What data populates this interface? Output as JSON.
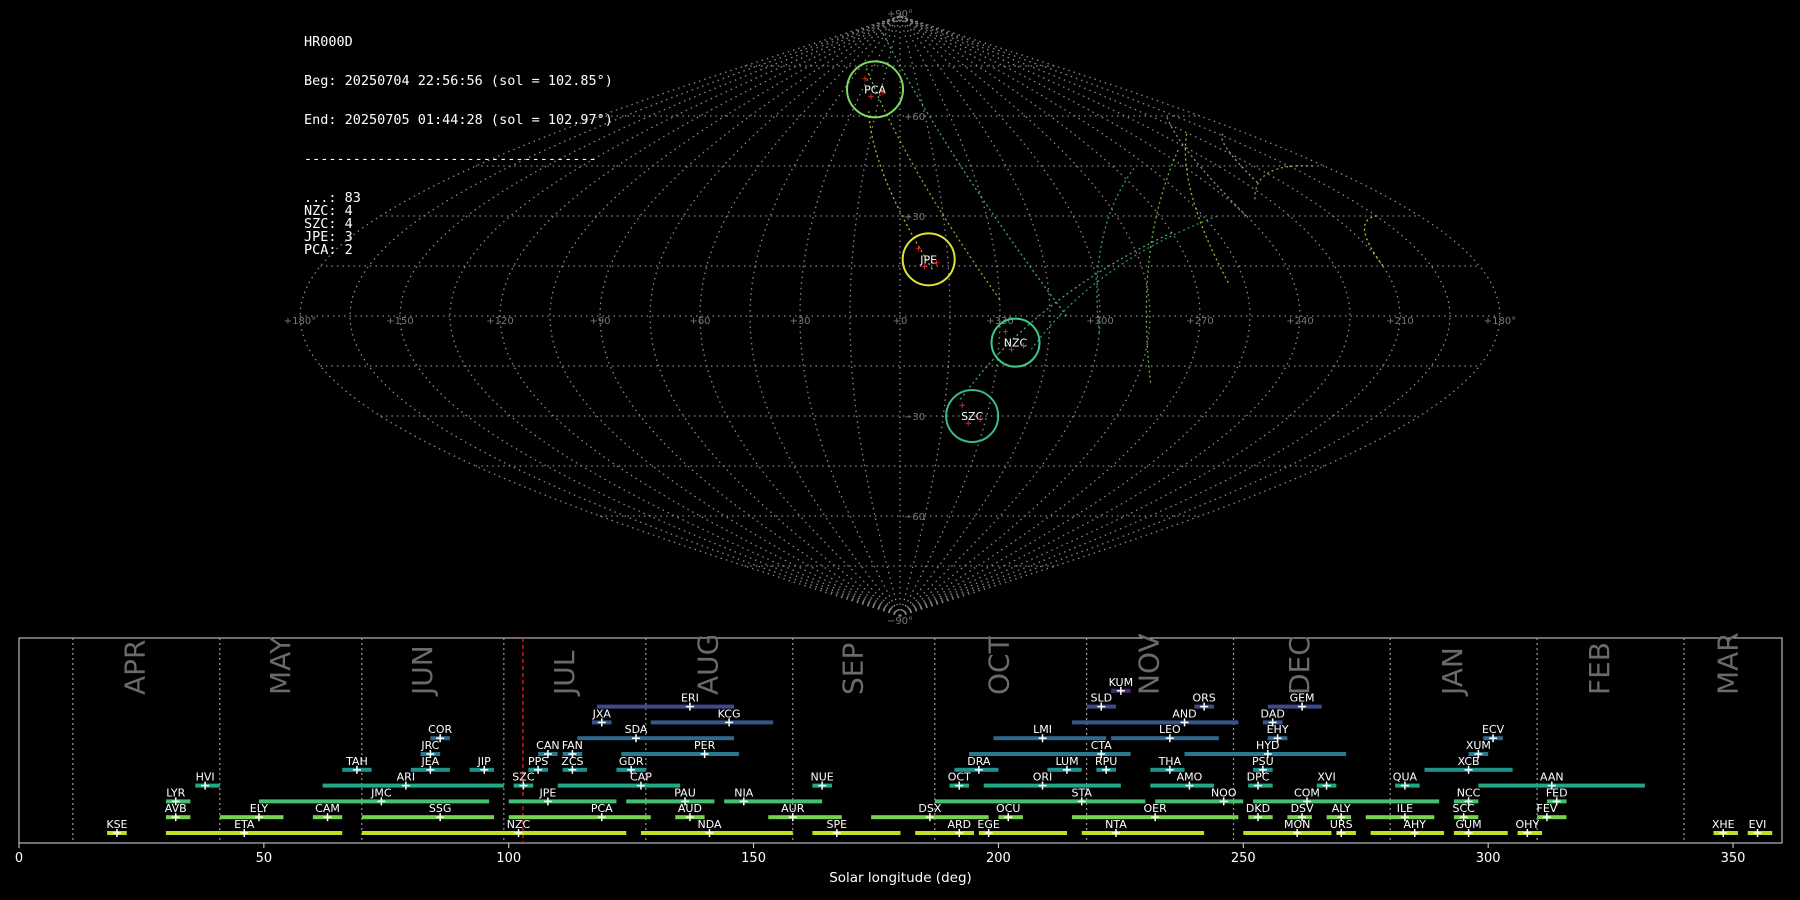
{
  "info": {
    "station": "HR000D",
    "beg": "Beg: 20250704 22:56:56 (sol = 102.85°)",
    "end": "End: 20250705 01:44:28 (sol = 102.97°)",
    "separator": "------------------------------------",
    "counts": [
      {
        "label": "...",
        "value": "83"
      },
      {
        "label": "NZC",
        "value": "4"
      },
      {
        "label": "SZC",
        "value": "4"
      },
      {
        "label": "JPE",
        "value": "3"
      },
      {
        "label": "PCA",
        "value": "2"
      }
    ]
  },
  "sky_map": {
    "projection": "sinusoidal",
    "pole_labels": [
      "+90°",
      "−90°"
    ],
    "lat_labels": [
      {
        "lat": 60,
        "text": "+60"
      },
      {
        "lat": 30,
        "text": "+30"
      },
      {
        "lat": -30,
        "text": "−30"
      },
      {
        "lat": -60,
        "text": "−60"
      }
    ],
    "lon_labels": [
      "+180°",
      "+150",
      "+120",
      "+90",
      "+60",
      "+30",
      "+0",
      "+330",
      "+300",
      "+270",
      "+240",
      "+210",
      "+180°"
    ],
    "showers": [
      {
        "code": "PCA",
        "lon": 20,
        "lat": 68,
        "r": 28,
        "color": "#7fd860"
      },
      {
        "code": "JPE",
        "lon": -9,
        "lat": 17,
        "r": 26,
        "color": "#e0e23a"
      },
      {
        "code": "NZC",
        "lon": -35,
        "lat": -8,
        "r": 24,
        "color": "#3fc888"
      },
      {
        "code": "SZC",
        "lon": -25,
        "lat": -30,
        "r": 26,
        "color": "#36b890"
      }
    ]
  },
  "chart_data": {
    "type": "timeline",
    "xlabel": "Solar longitude (deg)",
    "xlim": [
      0,
      360
    ],
    "xticks": [
      0,
      50,
      100,
      150,
      200,
      250,
      300,
      350
    ],
    "current_sol": 102.9,
    "months": [
      {
        "label": "APR",
        "start": 11,
        "end": 41
      },
      {
        "label": "MAY",
        "start": 41,
        "end": 70
      },
      {
        "label": "JUN",
        "start": 70,
        "end": 99
      },
      {
        "label": "JUL",
        "start": 99,
        "end": 128
      },
      {
        "label": "AUG",
        "start": 128,
        "end": 158
      },
      {
        "label": "SEP",
        "start": 158,
        "end": 187
      },
      {
        "label": "OCT",
        "start": 187,
        "end": 218
      },
      {
        "label": "NOV",
        "start": 218,
        "end": 248
      },
      {
        "label": "DEC",
        "start": 248,
        "end": 280
      },
      {
        "label": "JAN",
        "start": 280,
        "end": 310
      },
      {
        "label": "FEB",
        "start": 310,
        "end": 340
      },
      {
        "label": "MAR",
        "start": 340,
        "end": 371
      }
    ],
    "showers": [
      {
        "code": "KUM",
        "row": 9,
        "start": 223,
        "end": 227,
        "peak": 225,
        "color": "#482878"
      },
      {
        "code": "ERI",
        "row": 8,
        "start": 118,
        "end": 146,
        "peak": 137,
        "color": "#3e4a89"
      },
      {
        "code": "SLD",
        "row": 8,
        "start": 218,
        "end": 224,
        "peak": 221,
        "color": "#3e4a89"
      },
      {
        "code": "ORS",
        "row": 8,
        "start": 240,
        "end": 244,
        "peak": 242,
        "color": "#3e4a89"
      },
      {
        "code": "GEM",
        "row": 8,
        "start": 255,
        "end": 266,
        "peak": 262,
        "color": "#3e4a89"
      },
      {
        "code": "JXA",
        "row": 7,
        "start": 117,
        "end": 121,
        "peak": 119,
        "color": "#39568c"
      },
      {
        "code": "KCG",
        "row": 7,
        "start": 129,
        "end": 154,
        "peak": 145,
        "color": "#39568c"
      },
      {
        "code": "AND",
        "row": 7,
        "start": 215,
        "end": 249,
        "peak": 238,
        "color": "#39568c"
      },
      {
        "code": "DAD",
        "row": 7,
        "start": 254,
        "end": 258,
        "peak": 256,
        "color": "#39568c"
      },
      {
        "code": "COR",
        "row": 6,
        "start": 84,
        "end": 88,
        "peak": 86,
        "color": "#31688e"
      },
      {
        "code": "SDA",
        "row": 6,
        "start": 114,
        "end": 146,
        "peak": 126,
        "color": "#31688e"
      },
      {
        "code": "LMI",
        "row": 6,
        "start": 199,
        "end": 222,
        "peak": 209,
        "color": "#31688e"
      },
      {
        "code": "LEO",
        "row": 6,
        "start": 223,
        "end": 245,
        "peak": 235,
        "color": "#31688e"
      },
      {
        "code": "EHY",
        "row": 6,
        "start": 255,
        "end": 259,
        "peak": 257,
        "color": "#31688e"
      },
      {
        "code": "ECV",
        "row": 6,
        "start": 299,
        "end": 303,
        "peak": 301,
        "color": "#31688e"
      },
      {
        "code": "JRC",
        "row": 5,
        "start": 82,
        "end": 86,
        "peak": 84,
        "color": "#2a788e"
      },
      {
        "code": "CAN",
        "row": 5,
        "start": 106,
        "end": 110,
        "peak": 108,
        "color": "#2a788e"
      },
      {
        "code": "FAN",
        "row": 5,
        "start": 111,
        "end": 115,
        "peak": 113,
        "color": "#2a788e"
      },
      {
        "code": "PER",
        "row": 5,
        "start": 123,
        "end": 147,
        "peak": 140,
        "color": "#2a788e"
      },
      {
        "code": "CTA",
        "row": 5,
        "start": 194,
        "end": 227,
        "peak": 221,
        "color": "#2a788e"
      },
      {
        "code": "HYD",
        "row": 5,
        "start": 238,
        "end": 271,
        "peak": 255,
        "color": "#2a788e"
      },
      {
        "code": "XUM",
        "row": 5,
        "start": 296,
        "end": 300,
        "peak": 298,
        "color": "#2a788e"
      },
      {
        "code": "TAH",
        "row": 4,
        "start": 66,
        "end": 72,
        "peak": 69,
        "color": "#21918c"
      },
      {
        "code": "JEA",
        "row": 4,
        "start": 80,
        "end": 88,
        "peak": 84,
        "color": "#21918c"
      },
      {
        "code": "JIP",
        "row": 4,
        "start": 92,
        "end": 97,
        "peak": 95,
        "color": "#21918c"
      },
      {
        "code": "PPS",
        "row": 4,
        "start": 104,
        "end": 108,
        "peak": 106,
        "color": "#21918c"
      },
      {
        "code": "ZCS",
        "row": 4,
        "start": 111,
        "end": 116,
        "peak": 113,
        "color": "#21918c"
      },
      {
        "code": "GDR",
        "row": 4,
        "start": 122,
        "end": 128,
        "peak": 125,
        "color": "#21918c"
      },
      {
        "code": "DRA",
        "row": 4,
        "start": 191,
        "end": 200,
        "peak": 196,
        "color": "#21918c"
      },
      {
        "code": "LUM",
        "row": 4,
        "start": 210,
        "end": 217,
        "peak": 214,
        "color": "#21918c"
      },
      {
        "code": "RPU",
        "row": 4,
        "start": 220,
        "end": 224,
        "peak": 222,
        "color": "#21918c"
      },
      {
        "code": "THA",
        "row": 4,
        "start": 231,
        "end": 238,
        "peak": 235,
        "color": "#21918c"
      },
      {
        "code": "PSU",
        "row": 4,
        "start": 252,
        "end": 256,
        "peak": 254,
        "color": "#21918c"
      },
      {
        "code": "XCB",
        "row": 4,
        "start": 287,
        "end": 305,
        "peak": 296,
        "color": "#21918c"
      },
      {
        "code": "HVI",
        "row": 3,
        "start": 36,
        "end": 41,
        "peak": 38,
        "color": "#22a884"
      },
      {
        "code": "ARI",
        "row": 3,
        "start": 62,
        "end": 99,
        "peak": 79,
        "color": "#22a884"
      },
      {
        "code": "SZC",
        "row": 3,
        "start": 101,
        "end": 105,
        "peak": 103,
        "color": "#22a884"
      },
      {
        "code": "CAP",
        "row": 3,
        "start": 110,
        "end": 135,
        "peak": 127,
        "color": "#22a884"
      },
      {
        "code": "NUE",
        "row": 3,
        "start": 162,
        "end": 166,
        "peak": 164,
        "color": "#22a884"
      },
      {
        "code": "OCT",
        "row": 3,
        "start": 190,
        "end": 194,
        "peak": 192,
        "color": "#22a884"
      },
      {
        "code": "ORI",
        "row": 3,
        "start": 197,
        "end": 225,
        "peak": 209,
        "color": "#22a884"
      },
      {
        "code": "AMO",
        "row": 3,
        "start": 231,
        "end": 244,
        "peak": 239,
        "color": "#22a884"
      },
      {
        "code": "DPC",
        "row": 3,
        "start": 251,
        "end": 256,
        "peak": 253,
        "color": "#22a884"
      },
      {
        "code": "XVI",
        "row": 3,
        "start": 265,
        "end": 269,
        "peak": 267,
        "color": "#22a884"
      },
      {
        "code": "QUA",
        "row": 3,
        "start": 281,
        "end": 286,
        "peak": 283,
        "color": "#22a884"
      },
      {
        "code": "AAN",
        "row": 3,
        "start": 298,
        "end": 332,
        "peak": 313,
        "color": "#22a884"
      },
      {
        "code": "LYR",
        "row": 2,
        "start": 30,
        "end": 35,
        "peak": 32,
        "color": "#44bf70"
      },
      {
        "code": "JMC",
        "row": 2,
        "start": 49,
        "end": 96,
        "peak": 74,
        "color": "#44bf70"
      },
      {
        "code": "JPE",
        "row": 2,
        "start": 100,
        "end": 122,
        "peak": 108,
        "color": "#44bf70"
      },
      {
        "code": "PAU",
        "row": 2,
        "start": 124,
        "end": 142,
        "peak": 136,
        "color": "#44bf70"
      },
      {
        "code": "NIA",
        "row": 2,
        "start": 144,
        "end": 164,
        "peak": 148,
        "color": "#44bf70"
      },
      {
        "code": "STA",
        "row": 2,
        "start": 187,
        "end": 230,
        "peak": 217,
        "color": "#44bf70"
      },
      {
        "code": "NOO",
        "row": 2,
        "start": 232,
        "end": 250,
        "peak": 246,
        "color": "#44bf70"
      },
      {
        "code": "COM",
        "row": 2,
        "start": 252,
        "end": 290,
        "peak": 263,
        "color": "#44bf70"
      },
      {
        "code": "NCC",
        "row": 2,
        "start": 293,
        "end": 298,
        "peak": 296,
        "color": "#44bf70"
      },
      {
        "code": "FED",
        "row": 2,
        "start": 312,
        "end": 316,
        "peak": 314,
        "color": "#44bf70"
      },
      {
        "code": "AVB",
        "row": 1,
        "start": 30,
        "end": 35,
        "peak": 32,
        "color": "#7ad151"
      },
      {
        "code": "ELY",
        "row": 1,
        "start": 41,
        "end": 54,
        "peak": 49,
        "color": "#7ad151"
      },
      {
        "code": "CAM",
        "row": 1,
        "start": 60,
        "end": 66,
        "peak": 63,
        "color": "#7ad151"
      },
      {
        "code": "SSG",
        "row": 1,
        "start": 70,
        "end": 97,
        "peak": 86,
        "color": "#7ad151"
      },
      {
        "code": "PCA",
        "row": 1,
        "start": 100,
        "end": 129,
        "peak": 119,
        "color": "#7ad151"
      },
      {
        "code": "AUD",
        "row": 1,
        "start": 134,
        "end": 140,
        "peak": 137,
        "color": "#7ad151"
      },
      {
        "code": "AUR",
        "row": 1,
        "start": 153,
        "end": 168,
        "peak": 158,
        "color": "#7ad151"
      },
      {
        "code": "DSX",
        "row": 1,
        "start": 174,
        "end": 198,
        "peak": 186,
        "color": "#7ad151"
      },
      {
        "code": "OCU",
        "row": 1,
        "start": 200,
        "end": 205,
        "peak": 202,
        "color": "#7ad151"
      },
      {
        "code": "OER",
        "row": 1,
        "start": 215,
        "end": 249,
        "peak": 232,
        "color": "#7ad151"
      },
      {
        "code": "DKD",
        "row": 1,
        "start": 251,
        "end": 256,
        "peak": 253,
        "color": "#7ad151"
      },
      {
        "code": "DSV",
        "row": 1,
        "start": 259,
        "end": 264,
        "peak": 262,
        "color": "#7ad151"
      },
      {
        "code": "ALY",
        "row": 1,
        "start": 267,
        "end": 272,
        "peak": 270,
        "color": "#7ad151"
      },
      {
        "code": "ILE",
        "row": 1,
        "start": 275,
        "end": 289,
        "peak": 283,
        "color": "#7ad151"
      },
      {
        "code": "SCC",
        "row": 1,
        "start": 293,
        "end": 298,
        "peak": 295,
        "color": "#7ad151"
      },
      {
        "code": "FEV",
        "row": 1,
        "start": 310,
        "end": 316,
        "peak": 312,
        "color": "#7ad151"
      },
      {
        "code": "KSE",
        "row": 0,
        "start": 18,
        "end": 22,
        "peak": 20,
        "color": "#bddf26"
      },
      {
        "code": "ETA",
        "row": 0,
        "start": 30,
        "end": 66,
        "peak": 46,
        "color": "#bddf26"
      },
      {
        "code": "NZC",
        "row": 0,
        "start": 70,
        "end": 124,
        "peak": 102,
        "color": "#bddf26"
      },
      {
        "code": "NDA",
        "row": 0,
        "start": 127,
        "end": 158,
        "peak": 141,
        "color": "#bddf26"
      },
      {
        "code": "SPE",
        "row": 0,
        "start": 162,
        "end": 180,
        "peak": 167,
        "color": "#bddf26"
      },
      {
        "code": "ARD",
        "row": 0,
        "start": 183,
        "end": 195,
        "peak": 192,
        "color": "#bddf26"
      },
      {
        "code": "EGE",
        "row": 0,
        "start": 196,
        "end": 214,
        "peak": 198,
        "color": "#bddf26"
      },
      {
        "code": "NTA",
        "row": 0,
        "start": 217,
        "end": 242,
        "peak": 224,
        "color": "#bddf26"
      },
      {
        "code": "MON",
        "row": 0,
        "start": 250,
        "end": 268,
        "peak": 261,
        "color": "#bddf26"
      },
      {
        "code": "URS",
        "row": 0,
        "start": 269,
        "end": 273,
        "peak": 270,
        "color": "#bddf26"
      },
      {
        "code": "AHY",
        "row": 0,
        "start": 276,
        "end": 291,
        "peak": 285,
        "color": "#bddf26"
      },
      {
        "code": "GUM",
        "row": 0,
        "start": 293,
        "end": 304,
        "peak": 296,
        "color": "#bddf26"
      },
      {
        "code": "OHY",
        "row": 0,
        "start": 306,
        "end": 311,
        "peak": 308,
        "color": "#bddf26"
      },
      {
        "code": "XHE",
        "row": 0,
        "start": 346,
        "end": 351,
        "peak": 348,
        "color": "#bddf26"
      },
      {
        "code": "EVI",
        "row": 0,
        "start": 353,
        "end": 358,
        "peak": 355,
        "color": "#bddf26"
      }
    ]
  }
}
